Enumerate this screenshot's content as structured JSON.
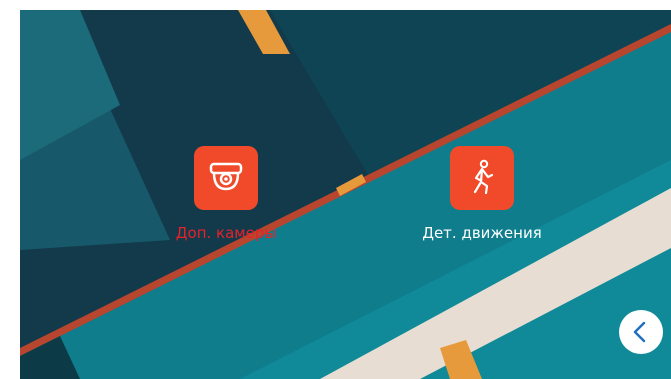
{
  "apps": [
    {
      "label": "Доп. камеры",
      "icon": "dome-camera-icon",
      "selected": true
    },
    {
      "label": "Дет. движения",
      "icon": "walking-person-icon",
      "selected": false
    }
  ],
  "navigation": {
    "back_icon": "chevron-left-icon"
  },
  "colors": {
    "tile_background": "#f04a2a",
    "selected_label": "#e8202a",
    "label": "#ffffff",
    "wallpaper_dark": "#123a4b",
    "wallpaper_teal": "#0f7d8c",
    "wallpaper_stripe": "#e8ddd3",
    "wallpaper_accent": "#e79a3c"
  }
}
